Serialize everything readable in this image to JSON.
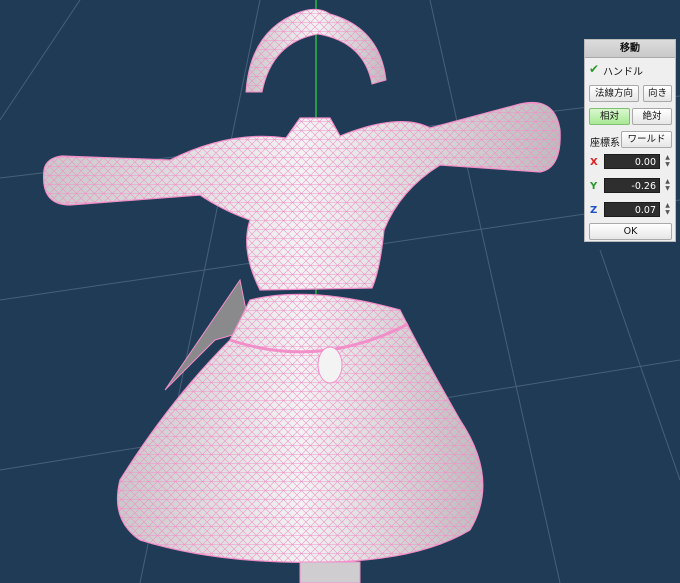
{
  "panel": {
    "title": "移動",
    "handle_label": "ハンドル",
    "handle_checked": true,
    "normal_button": "法線方向",
    "direction_button": "向き",
    "relative_button": "相対",
    "absolute_button": "絶対",
    "relative_active": true,
    "coord_label": "座標系",
    "world_button": "ワールド",
    "x_label": "X",
    "y_label": "Y",
    "z_label": "Z",
    "x_value": "0.00",
    "y_value": "-0.26",
    "z_value": "0.07",
    "ok_button": "OK",
    "colors": {
      "x": "#d22",
      "y": "#2a9a2a",
      "z": "#2050c8",
      "active": "#a8ea94"
    }
  },
  "viewport": {
    "background": "#1f3b56",
    "mesh_fill": "#f2f1f1",
    "wire_color": "#f28fc8",
    "axis_color": "#2ecc40"
  }
}
